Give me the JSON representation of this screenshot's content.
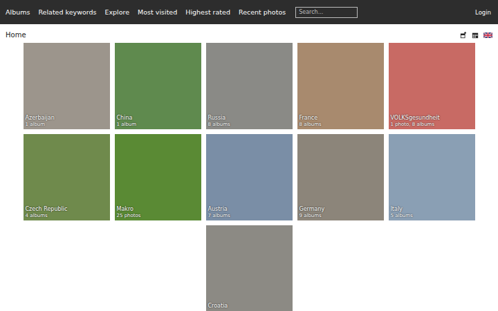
{
  "top_bar": {
    "nav": [
      {
        "label": "Albums"
      },
      {
        "label": "Related keywords"
      },
      {
        "label": "Explore"
      },
      {
        "label": "Most visited"
      },
      {
        "label": "Highest rated"
      },
      {
        "label": "Recent photos"
      }
    ],
    "search": {
      "placeholder": "Search..."
    },
    "login": "Login"
  },
  "breadcrumb": {
    "label": "Home"
  },
  "albums": [
    {
      "name": "Azerbaijan",
      "count": "1 album",
      "color": "#9c958c"
    },
    {
      "name": "China",
      "count": "1 album",
      "color": "#5f8a4e"
    },
    {
      "name": "Russia",
      "count": "8 albums",
      "color": "#8a8a86"
    },
    {
      "name": "France",
      "count": "8 albums",
      "color": "#a88a6e"
    },
    {
      "name": "VOLKSgesundheit",
      "count": "1 photo, 8 albums",
      "color": "#c86a64"
    },
    {
      "name": "Czech Republic",
      "count": "4 albums",
      "color": "#6f8a4c"
    },
    {
      "name": "Makro",
      "count": "25 photos",
      "color": "#5a8a34"
    },
    {
      "name": "Austria",
      "count": "7 albums",
      "color": "#7a8ea6"
    },
    {
      "name": "Germany",
      "count": "9 albums",
      "color": "#8c857a"
    },
    {
      "name": "Italy",
      "count": "5 albums",
      "color": "#8a9fb4"
    },
    {
      "name": "Croatia",
      "count": "",
      "color": "#8c8a84"
    }
  ]
}
